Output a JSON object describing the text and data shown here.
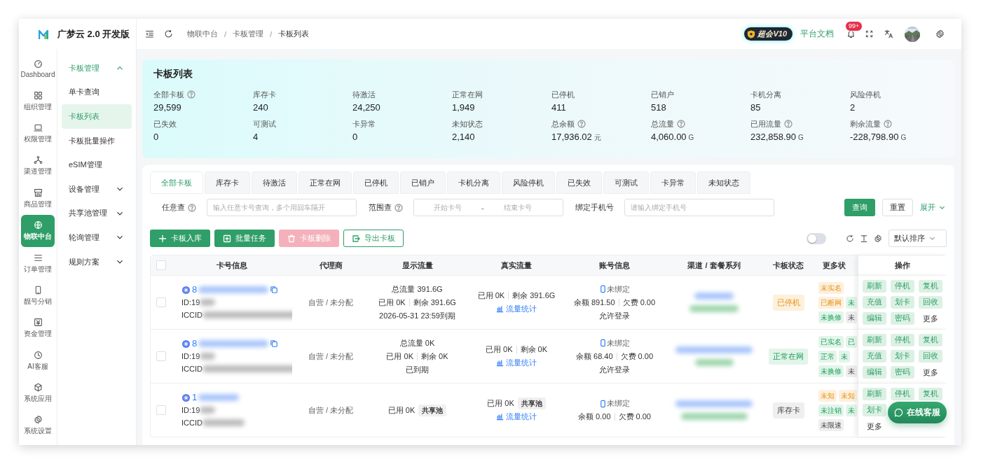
{
  "brand": {
    "name": "广梦云 2.0 开发版"
  },
  "header": {
    "breadcrumb": [
      "物联中台",
      "卡板管理",
      "卡板列表"
    ],
    "breadcrumb_separator": "/",
    "vip_badge": "超会V10",
    "docs_link": "平台文档",
    "notification_count": "99+"
  },
  "rail": [
    {
      "label": "Dashboard",
      "selected": false
    },
    {
      "label": "组织管理",
      "selected": false
    },
    {
      "label": "权限管理",
      "selected": false
    },
    {
      "label": "渠道管理",
      "selected": false
    },
    {
      "label": "商品管理",
      "selected": false
    },
    {
      "label": "物联中台",
      "selected": true
    },
    {
      "label": "订单管理",
      "selected": false
    },
    {
      "label": "靓号分销",
      "selected": false
    },
    {
      "label": "资金管理",
      "selected": false
    },
    {
      "label": "AI客服",
      "selected": false
    },
    {
      "label": "系统应用",
      "selected": false
    },
    {
      "label": "系统设置",
      "selected": false
    }
  ],
  "submenu": [
    {
      "label": "卡板管理",
      "expanded": true,
      "children": [
        {
          "label": "单卡查询",
          "selected": false
        },
        {
          "label": "卡板列表",
          "selected": true
        },
        {
          "label": "卡板批量操作",
          "selected": false
        },
        {
          "label": "eSIM管理",
          "selected": false
        }
      ]
    },
    {
      "label": "设备管理",
      "expanded": false
    },
    {
      "label": "共享池管理",
      "expanded": false
    },
    {
      "label": "轮询管理",
      "expanded": false
    },
    {
      "label": "规则方案",
      "expanded": false
    }
  ],
  "summary": {
    "title": "卡板列表",
    "stats": [
      {
        "label": "全部卡板",
        "value": "29,599",
        "help": true
      },
      {
        "label": "库存卡",
        "value": "240",
        "help": false
      },
      {
        "label": "待激活",
        "value": "24,250",
        "help": false
      },
      {
        "label": "正常在网",
        "value": "1,949",
        "help": false
      },
      {
        "label": "已停机",
        "value": "411",
        "help": false
      },
      {
        "label": "已销户",
        "value": "518",
        "help": false
      },
      {
        "label": "卡机分离",
        "value": "85",
        "help": false
      },
      {
        "label": "风险停机",
        "value": "2",
        "help": false
      },
      {
        "label": "已失效",
        "value": "0",
        "help": false
      },
      {
        "label": "可测试",
        "value": "4",
        "help": false
      },
      {
        "label": "卡异常",
        "value": "0",
        "help": false
      },
      {
        "label": "未知状态",
        "value": "2,140",
        "help": false
      },
      {
        "label": "总余额",
        "value": "17,936.02",
        "unit": "元",
        "help": true
      },
      {
        "label": "总流量",
        "value": "4,060.00",
        "unit": "G",
        "help": true
      },
      {
        "label": "已用流量",
        "value": "232,858.90",
        "unit": "G",
        "help": true
      },
      {
        "label": "剩余流量",
        "value": "-228,798.90",
        "unit": "G",
        "help": true
      }
    ]
  },
  "tabs": [
    {
      "label": "全部卡板",
      "selected": true
    },
    {
      "label": "库存卡",
      "selected": false
    },
    {
      "label": "待激活",
      "selected": false
    },
    {
      "label": "正常在网",
      "selected": false
    },
    {
      "label": "已停机",
      "selected": false
    },
    {
      "label": "已销户",
      "selected": false
    },
    {
      "label": "卡机分离",
      "selected": false
    },
    {
      "label": "风险停机",
      "selected": false
    },
    {
      "label": "已失效",
      "selected": false
    },
    {
      "label": "可测试",
      "selected": false
    },
    {
      "label": "卡异常",
      "selected": false
    },
    {
      "label": "未知状态",
      "selected": false
    }
  ],
  "filters": [
    {
      "kind": "text",
      "label": "任意查",
      "help": true,
      "placeholder": "输入任意卡号查询，多个用回车隔开"
    },
    {
      "kind": "range",
      "label": "范围查",
      "help": true,
      "start_placeholder": "开始卡号",
      "separator": "-",
      "end_placeholder": "结束卡号"
    },
    {
      "kind": "text",
      "label": "绑定手机号",
      "help": false,
      "placeholder": "请输入绑定手机号"
    }
  ],
  "filter_actions": {
    "search": "查询",
    "reset": "重置",
    "expand": "展开"
  },
  "toolbar": {
    "buttons": [
      {
        "label": "卡板入库",
        "kind": "primary",
        "disabled": false
      },
      {
        "label": "批量任务",
        "kind": "primary",
        "disabled": false
      },
      {
        "label": "卡板删除",
        "kind": "danger",
        "disabled": true
      },
      {
        "label": "导出卡板",
        "kind": "outline",
        "disabled": false
      }
    ],
    "switch_on": false,
    "sort": "默认排序"
  },
  "table": {
    "columns": [
      "卡号信息",
      "代理商",
      "显示流量",
      "真实流量",
      "账号信息",
      "渠道 / 套餐系列",
      "卡板状态",
      "更多状",
      "操作"
    ],
    "all_checked": false,
    "rows": [
      {
        "checked": false,
        "card_prefix": "8",
        "copyable": true,
        "id_prefix": "ID:19",
        "iccid_prefix": "ICCID",
        "agent": "自营 / 未分配",
        "display": {
          "total": "总流量 391.6G",
          "used": "已用 0K",
          "remain": "剩余 391.6G",
          "expiry": "2026-05-31 23:59到期"
        },
        "real": {
          "used": "已用 0K",
          "remain": "剩余 391.6G",
          "stats_link": "流量统计"
        },
        "account": {
          "phone": "未绑定",
          "balance": "余额 891.50",
          "arrears": "欠费 0.00",
          "login": "允许登录"
        },
        "status": {
          "label": "已停机",
          "kind": "warning"
        },
        "tags": [
          [
            {
              "label": "未实名",
              "kind": "warning"
            }
          ],
          [
            {
              "label": "已断网",
              "kind": "warning"
            },
            {
              "label": "未",
              "kind": "success"
            }
          ],
          [
            {
              "label": "未换修",
              "kind": "success"
            },
            {
              "label": "未",
              "kind": "neutral"
            }
          ]
        ],
        "ops": [
          [
            {
              "label": "刷新",
              "kind": "button"
            },
            {
              "label": "停机",
              "kind": "button"
            },
            {
              "label": "复机",
              "kind": "button"
            }
          ],
          [
            {
              "label": "充值",
              "kind": "button"
            },
            {
              "label": "划卡",
              "kind": "button"
            },
            {
              "label": "回收",
              "kind": "button"
            }
          ],
          [
            {
              "label": "编辑",
              "kind": "button"
            },
            {
              "label": "密码",
              "kind": "button"
            },
            {
              "label": "更多",
              "kind": "link"
            }
          ]
        ]
      },
      {
        "checked": false,
        "card_prefix": "8",
        "copyable": true,
        "id_prefix": "ID:19",
        "iccid_prefix": "ICCID",
        "agent": "自营 / 未分配",
        "display": {
          "total": "总流量 0K",
          "used": "已用 0K",
          "remain": "剩余 0K",
          "expiry": "已到期"
        },
        "real": {
          "used": "已用 0K",
          "remain": "剩余 0K",
          "stats_link": "流量统计"
        },
        "account": {
          "phone": "未绑定",
          "balance": "余额 68.40",
          "arrears": "欠费 0.00",
          "login": "允许登录"
        },
        "status": {
          "label": "正常在网",
          "kind": "success"
        },
        "tags": [
          [
            {
              "label": "已实名",
              "kind": "success"
            },
            {
              "label": "已",
              "kind": "success"
            }
          ],
          [
            {
              "label": "正常",
              "kind": "success"
            },
            {
              "label": "未",
              "kind": "success"
            }
          ],
          [
            {
              "label": "未换修",
              "kind": "success"
            },
            {
              "label": "未",
              "kind": "neutral"
            }
          ]
        ],
        "ops": [
          [
            {
              "label": "刷新",
              "kind": "button"
            },
            {
              "label": "停机",
              "kind": "button"
            },
            {
              "label": "复机",
              "kind": "button"
            }
          ],
          [
            {
              "label": "充值",
              "kind": "button"
            },
            {
              "label": "划卡",
              "kind": "button"
            },
            {
              "label": "回收",
              "kind": "button"
            }
          ],
          [
            {
              "label": "编辑",
              "kind": "button"
            },
            {
              "label": "密码",
              "kind": "button"
            },
            {
              "label": "更多",
              "kind": "link"
            }
          ]
        ]
      },
      {
        "checked": false,
        "card_prefix": "1",
        "copyable": false,
        "id_prefix": "ID:19",
        "iccid_prefix": "ICCID",
        "agent": "自营 / 未分配",
        "display": {
          "used": "已用 0K",
          "pool_tag": "共享池"
        },
        "real": {
          "used": "已用 0K",
          "pool_tag": "共享池",
          "stats_link": "流量统计"
        },
        "account": {
          "phone": "未绑定",
          "balance": "余额 0.00",
          "arrears": "欠费 0.00"
        },
        "status": {
          "label": "库存卡",
          "kind": "neutral"
        },
        "tags": [
          [
            {
              "label": "未知",
              "kind": "warning"
            },
            {
              "label": "未知",
              "kind": "warning"
            }
          ],
          [
            {
              "label": "未注销",
              "kind": "success"
            },
            {
              "label": "未",
              "kind": "success"
            }
          ],
          [
            {
              "label": "未限速",
              "kind": "neutral"
            }
          ]
        ],
        "ops": [
          [
            {
              "label": "刷新",
              "kind": "button"
            },
            {
              "label": "停机",
              "kind": "button"
            },
            {
              "label": "复机",
              "kind": "button"
            }
          ],
          [
            {
              "label": "划卡",
              "kind": "button"
            }
          ],
          [
            {
              "label": "更多",
              "kind": "link"
            }
          ]
        ]
      }
    ]
  },
  "chat_button": "在线客服"
}
